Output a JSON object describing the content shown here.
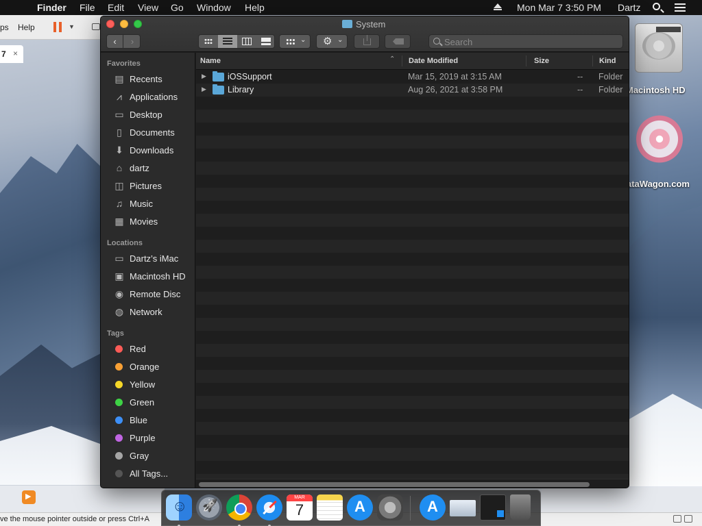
{
  "menubar": {
    "app_name": "Finder",
    "menus": [
      "File",
      "Edit",
      "View",
      "Go",
      "Window",
      "Help"
    ],
    "clock": "Mon Mar 7  3:50 PM",
    "user": "Dartz"
  },
  "background_app": {
    "menu_partial_1": "ps",
    "menu_partial_2": "Help",
    "tab_label": "7",
    "tab_close": "×",
    "status_message": "ve the mouse pointer outside or press Ctrl+A"
  },
  "desktop": {
    "icons": [
      {
        "label": "Macintosh HD",
        "icon": "hard-drive-icon"
      },
      {
        "label": "ataWagon.com",
        "icon": "datawagon-icon"
      }
    ]
  },
  "window": {
    "title": "System",
    "nav": {
      "back": "‹",
      "forward": "›"
    },
    "view_modes": [
      "icon",
      "list",
      "columns",
      "gallery"
    ],
    "active_view": "list",
    "search": {
      "placeholder": "Search",
      "value": ""
    },
    "sidebar": {
      "favorites_header": "Favorites",
      "favorites": [
        {
          "label": "Recents",
          "icon": "recents-icon",
          "glyph": "▤"
        },
        {
          "label": "Applications",
          "icon": "applications-icon",
          "glyph": "⩘"
        },
        {
          "label": "Desktop",
          "icon": "desktop-icon",
          "glyph": "▭"
        },
        {
          "label": "Documents",
          "icon": "documents-icon",
          "glyph": "▯"
        },
        {
          "label": "Downloads",
          "icon": "downloads-icon",
          "glyph": "⬇"
        },
        {
          "label": "dartz",
          "icon": "home-icon",
          "glyph": "⌂"
        },
        {
          "label": "Pictures",
          "icon": "pictures-icon",
          "glyph": "◫"
        },
        {
          "label": "Music",
          "icon": "music-icon",
          "glyph": "♫"
        },
        {
          "label": "Movies",
          "icon": "movies-icon",
          "glyph": "▦"
        }
      ],
      "locations_header": "Locations",
      "locations": [
        {
          "label": "Dartz’s iMac",
          "icon": "imac-icon",
          "glyph": "▭"
        },
        {
          "label": "Macintosh HD",
          "icon": "disk-icon",
          "glyph": "▣"
        },
        {
          "label": "Remote Disc",
          "icon": "remote-disc-icon",
          "glyph": "◉"
        },
        {
          "label": "Network",
          "icon": "network-icon",
          "glyph": "◍"
        }
      ],
      "tags_header": "Tags",
      "tags": [
        {
          "label": "Red",
          "color": "#fc5b57"
        },
        {
          "label": "Orange",
          "color": "#f8a035"
        },
        {
          "label": "Yellow",
          "color": "#f5d728"
        },
        {
          "label": "Green",
          "color": "#3ed245"
        },
        {
          "label": "Blue",
          "color": "#3d8ff6"
        },
        {
          "label": "Purple",
          "color": "#c065e2"
        },
        {
          "label": "Gray",
          "color": "#a5a5a5"
        },
        {
          "label": "All Tags...",
          "color": "#555555"
        }
      ]
    },
    "columns": {
      "name": "Name",
      "date": "Date Modified",
      "size": "Size",
      "kind": "Kind"
    },
    "files": [
      {
        "name": "iOSSupport",
        "date": "Mar 15, 2019 at 3:15 AM",
        "size": "--",
        "kind": "Folder"
      },
      {
        "name": "Library",
        "date": "Aug 26, 2021 at 3:58 PM",
        "size": "--",
        "kind": "Folder"
      }
    ]
  },
  "dock": {
    "calendar_month": "MAR",
    "calendar_day": "7",
    "apps": [
      "Finder",
      "Launchpad",
      "Google Chrome",
      "Safari",
      "Calendar",
      "Notes",
      "App Store",
      "System Preferences",
      "App Store",
      "Mail",
      "Terminal",
      "Trash"
    ]
  },
  "colors": {
    "menubar_bg": "#141414",
    "window_bg": "#1e1e1e",
    "sidebar_bg": "#2b2b2b",
    "folder_blue": "#5aa7d8"
  }
}
